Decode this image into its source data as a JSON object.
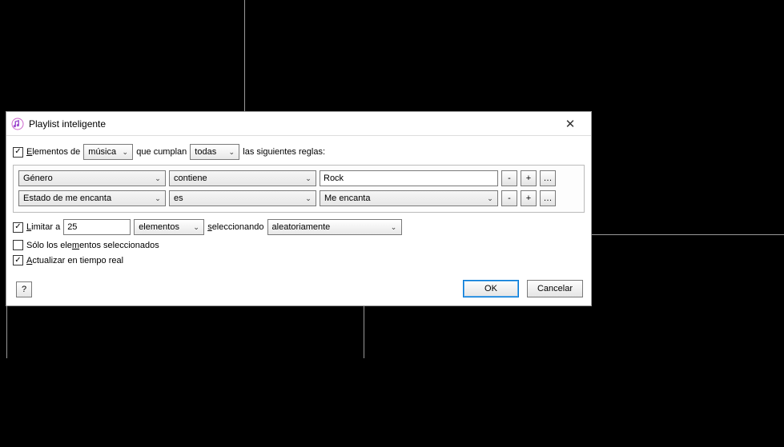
{
  "dialog": {
    "title": "Playlist inteligente"
  },
  "match": {
    "elements_label_pre": "E",
    "elements_label_post": "lementos de",
    "media_type": "música",
    "que_cumplan": "que cumplan",
    "condition": "todas",
    "trailing": "las siguientes reglas:"
  },
  "rules": [
    {
      "field": "Género",
      "operator": "contiene",
      "value": "Rock",
      "value_is_text": true
    },
    {
      "field": "Estado de me encanta",
      "operator": "es",
      "value": "Me encanta",
      "value_is_text": false
    }
  ],
  "rule_buttons": {
    "minus": "-",
    "plus": "+",
    "more": "…"
  },
  "limit": {
    "label_pre": "L",
    "label_post": "imitar a",
    "count": "25",
    "unit": "elementos",
    "selecting_pre": "s",
    "selecting_post": "eleccionando",
    "method": "aleatoriamente"
  },
  "only_selected": {
    "label_pre": "S",
    "label_mid": "ólo los ele",
    "label_u": "m",
    "label_post": "entos seleccionados"
  },
  "live_update": {
    "label_pre": "A",
    "label_post": "ctualizar en tiempo real"
  },
  "buttons": {
    "ok": "OK",
    "cancel": "Cancelar",
    "help": "?"
  }
}
